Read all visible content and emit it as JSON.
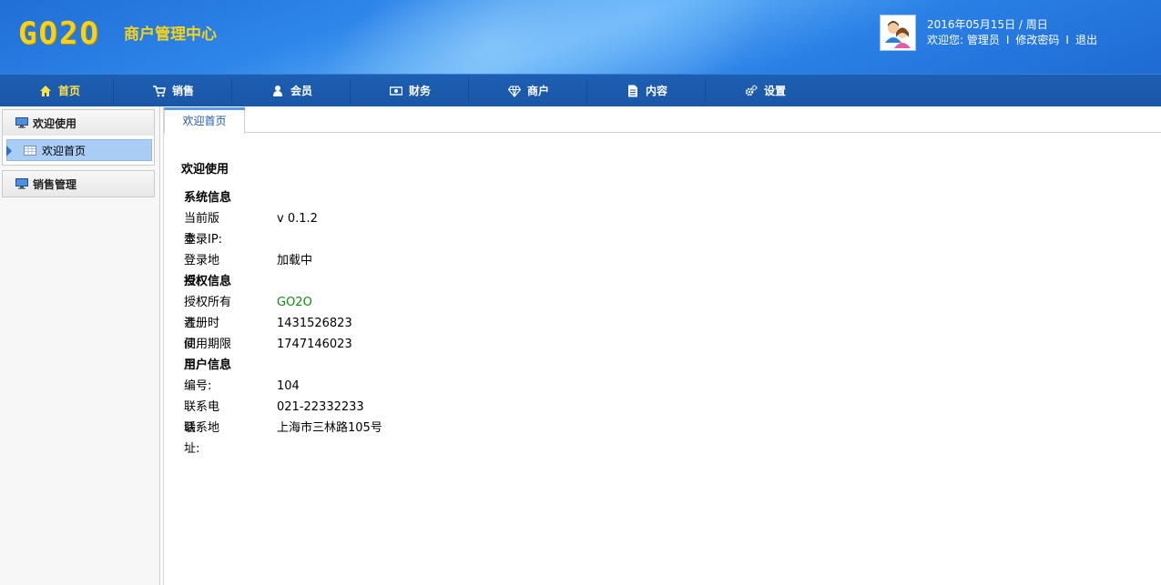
{
  "header": {
    "logo": "GO2O",
    "site_title": "商户管理中心",
    "date_line": "2016年05月15日 / 周日",
    "welcome": "欢迎您: 管理员",
    "sep": "I",
    "change_password": "修改密码",
    "sep2": "I",
    "logout": "退出"
  },
  "nav": [
    {
      "label": "首页",
      "icon": "home-icon",
      "active": true
    },
    {
      "label": "销售",
      "icon": "cart-icon"
    },
    {
      "label": "会员",
      "icon": "user-icon"
    },
    {
      "label": "财务",
      "icon": "money-icon"
    },
    {
      "label": "商户",
      "icon": "diamond-icon"
    },
    {
      "label": "内容",
      "icon": "document-icon"
    },
    {
      "label": "设置",
      "icon": "gears-icon"
    }
  ],
  "sidebar": {
    "groups": [
      {
        "title": "欢迎使用",
        "items": [
          {
            "label": "欢迎首页"
          }
        ]
      },
      {
        "title": "销售管理",
        "items": []
      }
    ]
  },
  "tabs": [
    {
      "label": "欢迎首页"
    }
  ],
  "main": {
    "title": "欢迎使用",
    "system": {
      "heading": "系统信息",
      "rows": [
        {
          "label": "当前版本:",
          "value": "v 0.1.2"
        },
        {
          "label": "登录IP:",
          "value": ""
        },
        {
          "label": "登录地点:",
          "value": "加载中"
        }
      ]
    },
    "license": {
      "heading": "授权信息",
      "rows": [
        {
          "label": "授权所有者:",
          "value": "GO2O"
        },
        {
          "label": "注册时间:",
          "value": "1431526823"
        },
        {
          "label": "使用期限至:",
          "value": "1747146023"
        }
      ]
    },
    "user": {
      "heading": "用户信息",
      "rows": [
        {
          "label": "编号:",
          "value": "104"
        },
        {
          "label": "联系电话:",
          "value": "021-22332233"
        },
        {
          "label": "联系地址:",
          "value": "上海市三林路105号"
        }
      ]
    }
  },
  "colors": {
    "header_blue": "#2a80e6",
    "nav_blue": "#1a56a5",
    "logo_yellow": "#f6d21a",
    "active_nav": "#ffe14a",
    "owner_green": "#118a11",
    "sidebar_selected": "#a9cdf5"
  }
}
